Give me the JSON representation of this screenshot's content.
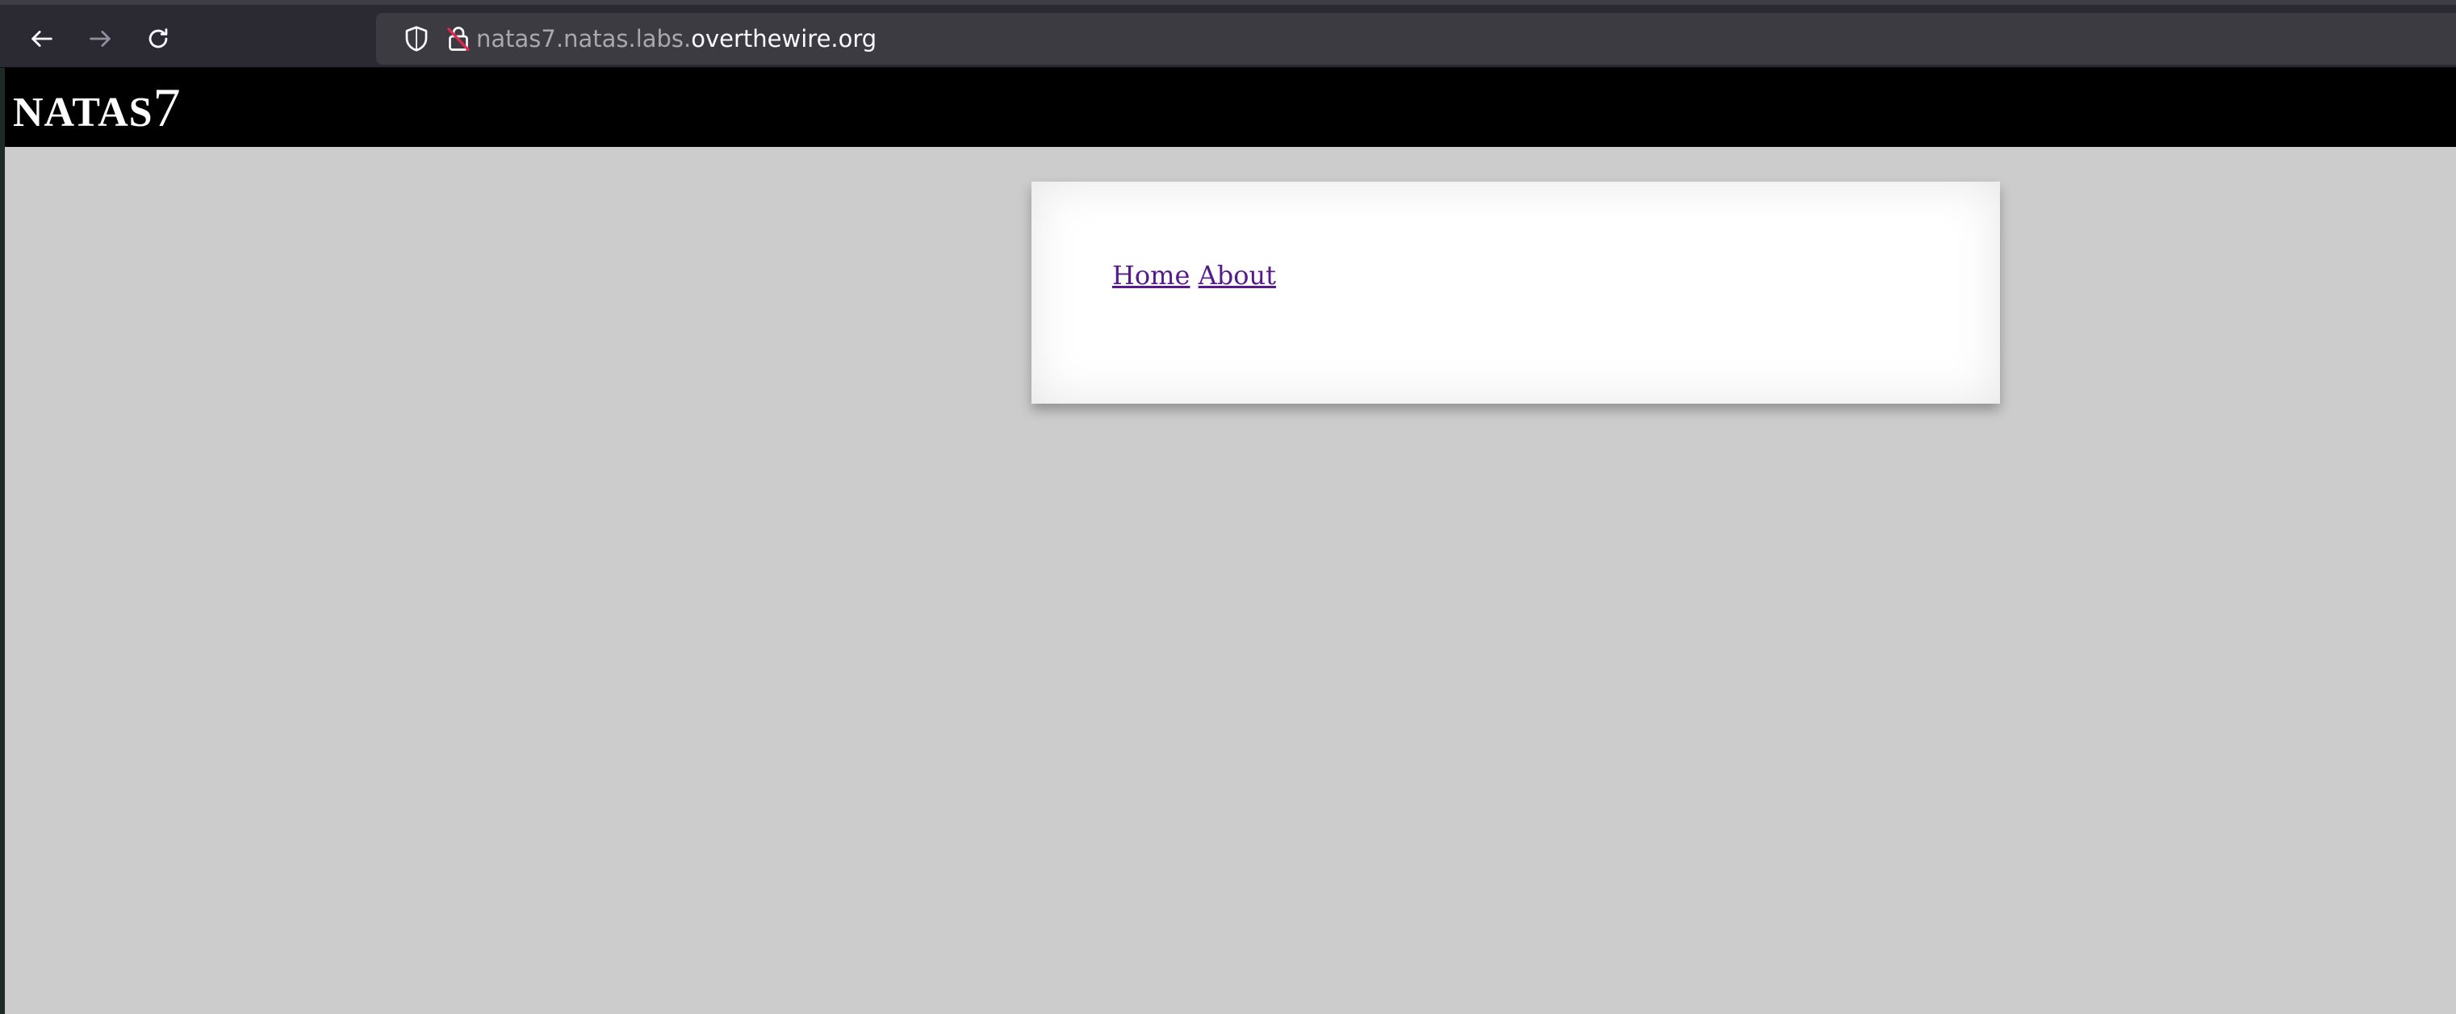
{
  "browser": {
    "url_subdomain": "natas7.natas.labs.",
    "url_domain": "overthewire.org",
    "icons": {
      "back": "arrow-left-icon",
      "forward": "arrow-right-icon",
      "reload": "reload-icon",
      "tracking_protection": "shield-icon",
      "insecure_lock": "lock-insecure-icon"
    }
  },
  "page": {
    "title_prefix": "NATAS",
    "title_level": "7",
    "links": {
      "home": "Home",
      "about": "About"
    }
  },
  "colors": {
    "toolbar": "#2b2a33",
    "urlbar": "#3c3b41",
    "header": "#000000",
    "page_background": "#cccccc",
    "content_background": "#ffffff",
    "visited_link": "#551a8b",
    "insecure_lock_accent": "#e22850"
  }
}
